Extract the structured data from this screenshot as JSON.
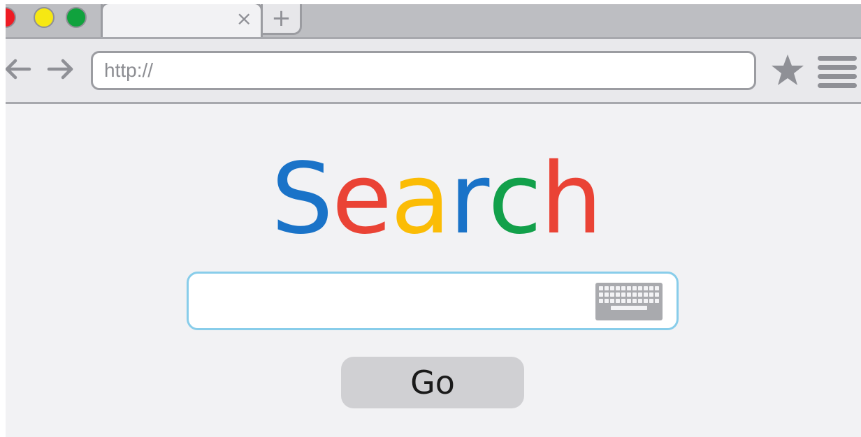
{
  "window": {
    "controls": [
      {
        "name": "close",
        "color": "#ee1c24"
      },
      {
        "name": "minimize",
        "color": "#f6e813"
      },
      {
        "name": "zoom",
        "color": "#10a23d"
      }
    ]
  },
  "tabs": {
    "active": {
      "title": "",
      "close_glyph": "×"
    },
    "new_tab_glyph": "+"
  },
  "toolbar": {
    "back_icon": "arrow-left-icon",
    "forward_icon": "arrow-right-icon",
    "url_placeholder": "http://",
    "bookmark_icon": "star-icon",
    "menu_icon": "hamburger-menu-icon"
  },
  "page": {
    "logo": {
      "letters": [
        {
          "char": "S",
          "color": "#1a73c8"
        },
        {
          "char": "e",
          "color": "#ea4335"
        },
        {
          "char": "a",
          "color": "#fbbc05"
        },
        {
          "char": "r",
          "color": "#1a73c8"
        },
        {
          "char": "c",
          "color": "#12a04a"
        },
        {
          "char": "h",
          "color": "#ea4335"
        }
      ]
    },
    "search": {
      "value": "",
      "border_color": "#88cdea",
      "keyboard_icon": "keyboard-icon"
    },
    "go_label": "Go"
  }
}
